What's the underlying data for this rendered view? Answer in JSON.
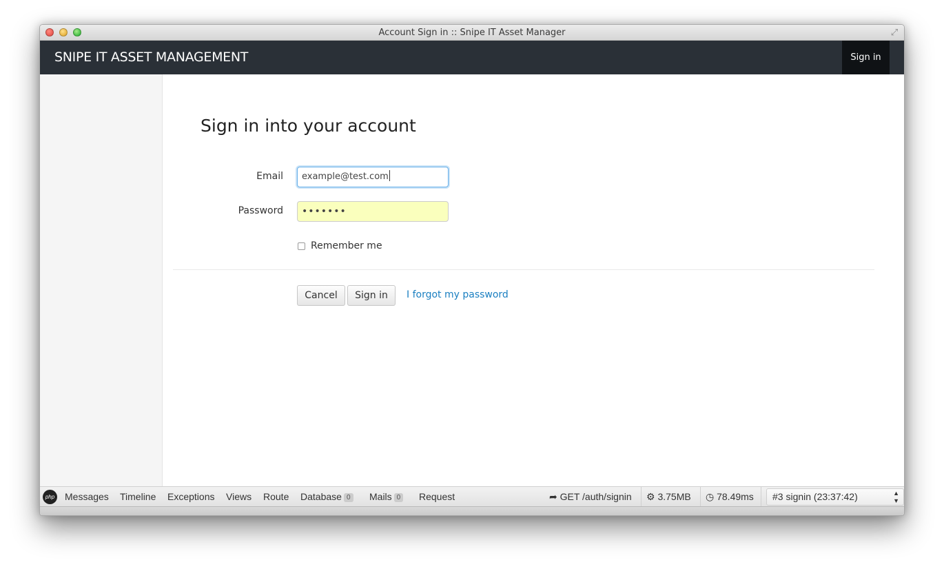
{
  "window": {
    "title": "Account Sign in :: Snipe IT Asset Manager"
  },
  "navbar": {
    "brand": "SNIPE IT ASSET MANAGEMENT",
    "signin_label": "Sign in"
  },
  "form": {
    "heading": "Sign in into your account",
    "email_label": "Email",
    "email_value": "example@test.com",
    "password_label": "Password",
    "password_value": "•••••••",
    "remember_label": "Remember me",
    "remember_checked": false,
    "cancel_label": "Cancel",
    "signin_label": "Sign in",
    "forgot_label": "I forgot my password"
  },
  "debugbar": {
    "logo": "php",
    "tabs": [
      {
        "label": "Messages"
      },
      {
        "label": "Timeline"
      },
      {
        "label": "Exceptions"
      },
      {
        "label": "Views"
      },
      {
        "label": "Route"
      },
      {
        "label": "Database",
        "badge": "0"
      },
      {
        "label": "Mails",
        "badge": "0"
      },
      {
        "label": "Request"
      }
    ],
    "route": "GET /auth/signin",
    "memory": "3.75MB",
    "time": "78.49ms",
    "request_select": "#3 signin (23:37:42)"
  },
  "colors": {
    "navbar": "#2a3037",
    "link": "#1a7fc1",
    "autofill": "#faffbd",
    "focus": "#66afe9"
  }
}
